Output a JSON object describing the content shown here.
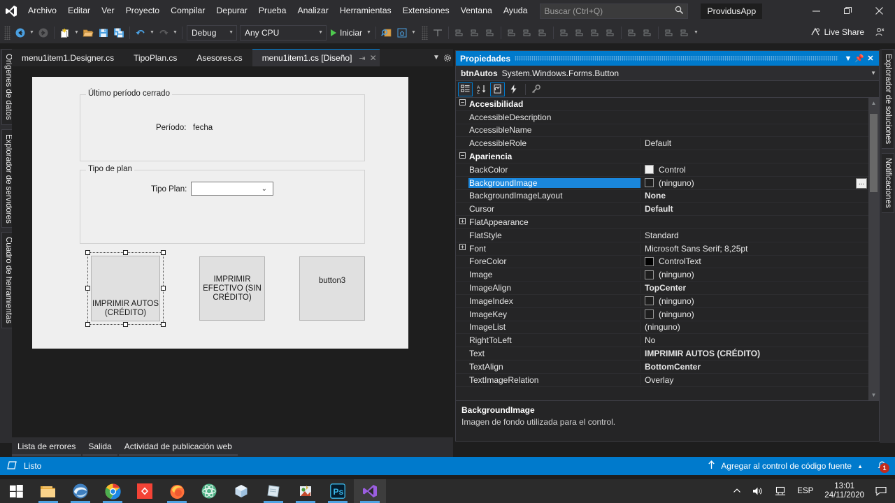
{
  "menubar": {
    "logo_icon": "visual-studio-logo",
    "items": [
      "Archivo",
      "Editar",
      "Ver",
      "Proyecto",
      "Compilar",
      "Depurar",
      "Prueba",
      "Analizar",
      "Herramientas",
      "Extensiones",
      "Ventana",
      "Ayuda"
    ],
    "search_placeholder": "Buscar (Ctrl+Q)",
    "app_name": "ProvidusApp",
    "window_controls": [
      "minimize",
      "restore",
      "close"
    ]
  },
  "toolbar": {
    "configuration": "Debug",
    "platform": "Any CPU",
    "start_label": "Iniciar",
    "live_share_label": "Live Share",
    "icons": [
      "navigate-back-icon",
      "navigate-forward-icon",
      "new-item-icon",
      "open-file-icon",
      "save-icon",
      "save-all-icon",
      "undo-icon",
      "redo-icon",
      "find-icon",
      "home-icon",
      "align-tools-icon"
    ]
  },
  "rails": {
    "left": [
      "Orígenes de datos",
      "Explorador de servidores",
      "Cuadro de herramientas"
    ],
    "right": [
      "Explorador de soluciones",
      "Notificaciones"
    ]
  },
  "tabs": [
    {
      "label": "menu1item1.Designer.cs",
      "active": false
    },
    {
      "label": "TipoPlan.cs",
      "active": false
    },
    {
      "label": "Asesores.cs",
      "active": false
    },
    {
      "label": "menu1item1.cs [Diseño]",
      "active": true
    }
  ],
  "designer": {
    "groupbox1_title": "Último período cerrado",
    "periodo_label": "Período:",
    "periodo_value": "fecha",
    "groupbox2_title": "Tipo de plan",
    "tipoplan_label": "Tipo Plan:",
    "tipoplan_value": "",
    "buttons": [
      {
        "text": "IMPRIMIR AUTOS (CRÉDITO)",
        "selected": true
      },
      {
        "text": "IMPRIMIR EFECTIVO (SIN CRÉDITO)",
        "selected": false
      },
      {
        "text": "button3",
        "selected": false
      }
    ]
  },
  "bottom_tabs": [
    "Lista de errores",
    "Salida",
    "Actividad de publicación web"
  ],
  "properties": {
    "title": "Propiedades",
    "object_name": "btnAutos",
    "object_type": "System.Windows.Forms.Button",
    "toolbar_icons": [
      "categorized-icon",
      "alphabetical-icon",
      "properties-page-icon",
      "events-icon",
      "property-pages-icon"
    ],
    "rows": [
      {
        "kind": "category",
        "expander": "-",
        "name": "Accesibilidad",
        "value": ""
      },
      {
        "kind": "prop",
        "name": "AccessibleDescription",
        "value": ""
      },
      {
        "kind": "prop",
        "name": "AccessibleName",
        "value": ""
      },
      {
        "kind": "prop",
        "name": "AccessibleRole",
        "value": "Default"
      },
      {
        "kind": "category",
        "expander": "-",
        "name": "Apariencia",
        "value": ""
      },
      {
        "kind": "prop",
        "name": "BackColor",
        "value": "Control",
        "swatch": "#f0f0f0"
      },
      {
        "kind": "prop",
        "name": "BackgroundImage",
        "value": "(ninguno)",
        "swatch": "#1e1e1e",
        "selected": true,
        "ellipsis": true
      },
      {
        "kind": "prop",
        "name": "BackgroundImageLayout",
        "value": "None",
        "bold": true
      },
      {
        "kind": "prop",
        "name": "Cursor",
        "value": "Default",
        "bold": true
      },
      {
        "kind": "prop",
        "expander": "+",
        "name": "FlatAppearance",
        "value": ""
      },
      {
        "kind": "prop",
        "name": "FlatStyle",
        "value": "Standard"
      },
      {
        "kind": "prop",
        "expander": "+",
        "name": "Font",
        "value": "Microsoft Sans Serif; 8,25pt"
      },
      {
        "kind": "prop",
        "name": "ForeColor",
        "value": "ControlText",
        "swatch": "#000000"
      },
      {
        "kind": "prop",
        "name": "Image",
        "value": "(ninguno)",
        "swatch": "#1e1e1e"
      },
      {
        "kind": "prop",
        "name": "ImageAlign",
        "value": "TopCenter",
        "bold": true
      },
      {
        "kind": "prop",
        "name": "ImageIndex",
        "value": "(ninguno)",
        "swatch": "#1e1e1e"
      },
      {
        "kind": "prop",
        "name": "ImageKey",
        "value": "(ninguno)",
        "swatch": "#1e1e1e"
      },
      {
        "kind": "prop",
        "name": "ImageList",
        "value": "(ninguno)"
      },
      {
        "kind": "prop",
        "name": "RightToLeft",
        "value": "No"
      },
      {
        "kind": "prop",
        "name": "Text",
        "value": "IMPRIMIR AUTOS (CRÉDITO)",
        "bold": true
      },
      {
        "kind": "prop",
        "name": "TextAlign",
        "value": "BottomCenter",
        "bold": true
      },
      {
        "kind": "prop",
        "name": "TextImageRelation",
        "value": "Overlay"
      }
    ],
    "description_title": "BackgroundImage",
    "description_text": "Imagen de fondo utilizada para el control."
  },
  "statusbar": {
    "status": "Listo",
    "source_control": "Agregar al control de código fuente",
    "notification_count": "1"
  },
  "taskbar": {
    "apps": [
      "start-icon",
      "file-explorer-icon",
      "edge-icon",
      "chrome-icon",
      "app-red-icon",
      "firefox-icon",
      "app-green-icon",
      "app-cube-icon",
      "app-notes-icon",
      "app-paint-icon",
      "photoshop-icon",
      "visual-studio-icon"
    ],
    "language": "ESP",
    "time": "13:01",
    "date": "24/11/2020"
  },
  "colors": {
    "accent": "#007acc",
    "selection": "#1a87dd",
    "panel_bg": "#252526",
    "chrome_bg": "#2d2d30",
    "editor_bg": "#1e1e1e",
    "form_bg": "#efefef",
    "badge_red": "#c42b1c"
  }
}
